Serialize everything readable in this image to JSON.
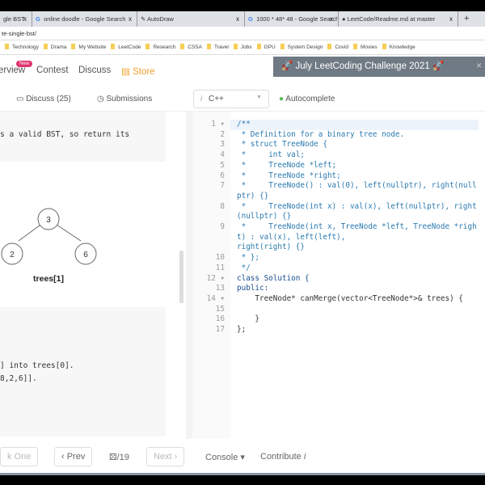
{
  "browser": {
    "tabs": [
      {
        "title": "gle BST",
        "icon": "leetcode-icon"
      },
      {
        "title": "online doodle - Google Search",
        "icon": "google-icon"
      },
      {
        "title": "AutoDraw",
        "icon": "autodraw-icon"
      },
      {
        "title": "1000 * 48* 48 - Google Search",
        "icon": "google-icon"
      },
      {
        "title": "LeetCode/Readme.md at master",
        "icon": "github-icon"
      }
    ],
    "close": "x",
    "new_tab": "+",
    "url": "te-single-bst/",
    "bookmarks": [
      "Technology",
      "Drama",
      "My Website",
      "LeetCode",
      "Research",
      "CSSA",
      "Travel",
      "Jobs",
      "GPU",
      "System Design",
      "Covid",
      "Movies",
      "Knowledge"
    ]
  },
  "nav": {
    "items": [
      "erview",
      "Contest",
      "Discuss",
      "Store"
    ],
    "new_badge": "New",
    "banner": "🚀 July LeetCoding Challenge 2021 🚀",
    "banner_close": "×"
  },
  "toolbar": {
    "discuss": "Discuss (25)",
    "submissions": "Submissions",
    "language": "C++",
    "lang_info": "i",
    "autocomplete": "Autocomplete"
  },
  "problem": {
    "text1": "s a valid BST, so return its",
    "tree": {
      "root": "3",
      "left": "2",
      "right": "6",
      "caption": "trees[1]"
    },
    "text2": "] into trees[0].",
    "text3": "8,2,6]]."
  },
  "editor": {
    "lines": [
      {
        "n": "1 ▾",
        "t": "/**",
        "c": "cm"
      },
      {
        "n": "2",
        "t": " * Definition for a binary tree node.",
        "c": "cm"
      },
      {
        "n": "3",
        "t": " * struct TreeNode {",
        "c": "cm"
      },
      {
        "n": "4",
        "t": " *     int val;",
        "c": "cm"
      },
      {
        "n": "5",
        "t": " *     TreeNode *left;",
        "c": "cm"
      },
      {
        "n": "6",
        "t": " *     TreeNode *right;",
        "c": "cm"
      },
      {
        "n": "7",
        "t": " *     TreeNode() : val(0), left(nullptr), right(nullptr) {}",
        "c": "cm"
      },
      {
        "n": "8",
        "t": " *     TreeNode(int x) : val(x), left(nullptr), right(nullptr) {}",
        "c": "cm"
      },
      {
        "n": "9",
        "t": " *     TreeNode(int x, TreeNode *left, TreeNode *right) : val(x), left(left),",
        "c": "cm"
      },
      {
        "n": "",
        "t": "right(right) {}",
        "c": "cm"
      },
      {
        "n": "10",
        "t": " * };",
        "c": "cm"
      },
      {
        "n": "11",
        "t": " */",
        "c": "cm"
      },
      {
        "n": "12 ▾",
        "t": "class Solution {",
        "c": "kw"
      },
      {
        "n": "13",
        "t": "public:",
        "c": "kw"
      },
      {
        "n": "14 ▾",
        "t": "    TreeNode* canMerge(vector<TreeNode*>& trees) {",
        "c": ""
      },
      {
        "n": "15",
        "t": "",
        "c": ""
      },
      {
        "n": "16",
        "t": "    }",
        "c": ""
      },
      {
        "n": "17",
        "t": "};",
        "c": ""
      }
    ]
  },
  "bottom": {
    "pick_one": "k One",
    "prev": "‹ Prev",
    "page": "⚄/19",
    "next": "Next ›",
    "console": "Console ▾",
    "contribute": "Contribute",
    "contribute_info": "i"
  }
}
